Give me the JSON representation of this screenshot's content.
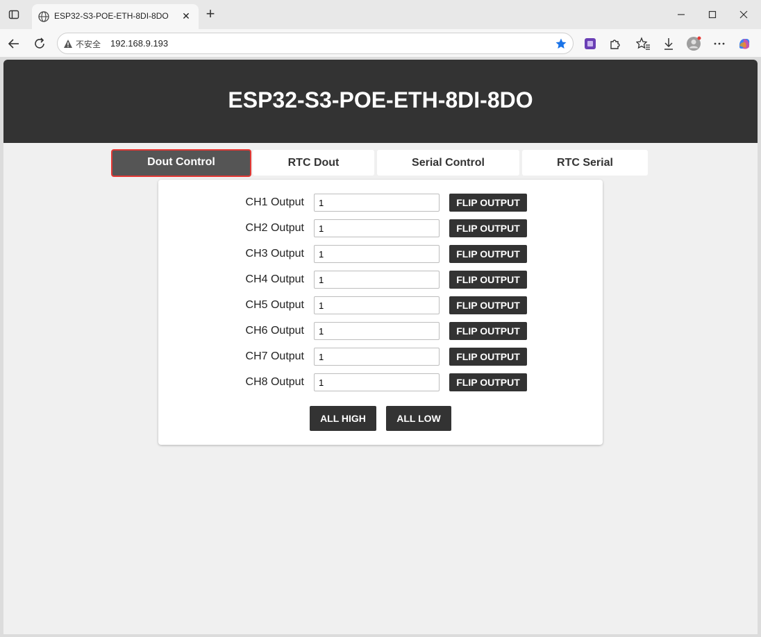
{
  "browser": {
    "tab_title": "ESP32-S3-POE-ETH-8DI-8DO",
    "security_label": "不安全",
    "url": "192.168.9.193"
  },
  "page": {
    "title": "ESP32-S3-POE-ETH-8DI-8DO",
    "tabs": [
      {
        "label": "Dout Control",
        "active": true
      },
      {
        "label": "RTC Dout",
        "active": false
      },
      {
        "label": "Serial Control",
        "active": false
      },
      {
        "label": "RTC Serial",
        "active": false
      }
    ],
    "channels": [
      {
        "label": "CH1 Output",
        "value": "1",
        "button": "FLIP OUTPUT"
      },
      {
        "label": "CH2 Output",
        "value": "1",
        "button": "FLIP OUTPUT"
      },
      {
        "label": "CH3 Output",
        "value": "1",
        "button": "FLIP OUTPUT"
      },
      {
        "label": "CH4 Output",
        "value": "1",
        "button": "FLIP OUTPUT"
      },
      {
        "label": "CH5 Output",
        "value": "1",
        "button": "FLIP OUTPUT"
      },
      {
        "label": "CH6 Output",
        "value": "1",
        "button": "FLIP OUTPUT"
      },
      {
        "label": "CH7 Output",
        "value": "1",
        "button": "FLIP OUTPUT"
      },
      {
        "label": "CH8 Output",
        "value": "1",
        "button": "FLIP OUTPUT"
      }
    ],
    "all_high_label": "ALL HIGH",
    "all_low_label": "ALL LOW"
  },
  "colors": {
    "header_bg": "#333333",
    "active_tab_bg": "#555555",
    "active_tab_border": "#e53935",
    "button_bg": "#333333",
    "page_bg": "#f0f0f0"
  },
  "icons": [
    "window-icon",
    "globe-icon",
    "close-icon",
    "plus-icon",
    "minimize-icon",
    "maximize-icon",
    "back-icon",
    "refresh-icon",
    "warning-icon",
    "star-icon",
    "extension-icon",
    "puzzle-icon",
    "favorites-icon",
    "download-icon",
    "profile-icon",
    "more-icon",
    "copilot-icon"
  ]
}
